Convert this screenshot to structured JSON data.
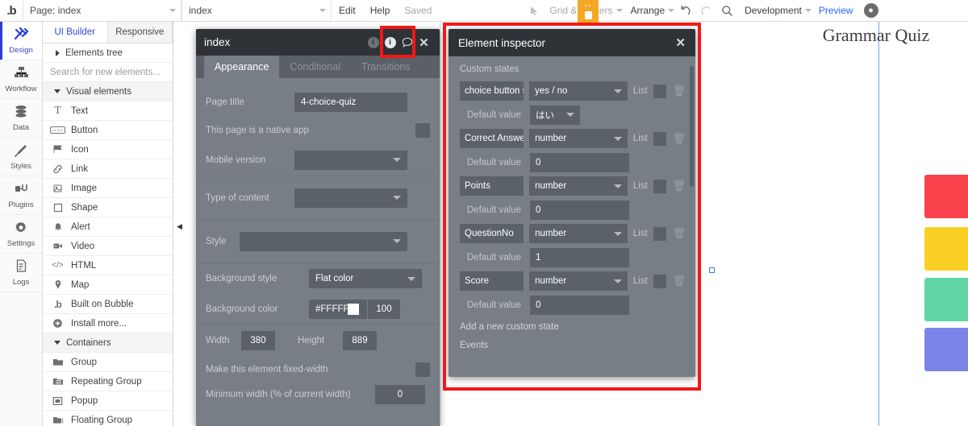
{
  "topbar": {
    "logo": "bubble-logo",
    "page_select": "Page: index",
    "element_select": "index",
    "edit": "Edit",
    "help": "Help",
    "saved": "Saved",
    "grid_borders": "Grid & borders",
    "arrange": "Arrange",
    "undo_icon": "undo-icon",
    "redo_icon": "redo-icon",
    "search_icon": "search-icon",
    "version": "Development",
    "preview": "Preview",
    "avatar_icon": "user-avatar-icon"
  },
  "rail": {
    "items": [
      {
        "label": "Design",
        "icon": "design-tools-icon",
        "active": true
      },
      {
        "label": "Workflow",
        "icon": "workflow-tree-icon",
        "active": false
      },
      {
        "label": "Data",
        "icon": "database-icon",
        "active": false
      },
      {
        "label": "Styles",
        "icon": "paintbrush-icon",
        "active": false
      },
      {
        "label": "Plugins",
        "icon": "plug-icon",
        "active": false
      },
      {
        "label": "Settings",
        "icon": "gear-icon",
        "active": false
      },
      {
        "label": "Logs",
        "icon": "document-icon",
        "active": false
      }
    ]
  },
  "palette": {
    "tabs": [
      {
        "label": "UI Builder",
        "active": true
      },
      {
        "label": "Responsive",
        "active": false
      }
    ],
    "elements_tree": "Elements tree",
    "search_placeholder": "Search for new elements...",
    "groups": [
      {
        "title": "Visual elements",
        "items": [
          {
            "label": "Text",
            "icon": "text-t-icon"
          },
          {
            "label": "Button",
            "icon": "button-icon"
          },
          {
            "label": "Icon",
            "icon": "flag-icon"
          },
          {
            "label": "Link",
            "icon": "link-chain-icon"
          },
          {
            "label": "Image",
            "icon": "image-icon"
          },
          {
            "label": "Shape",
            "icon": "square-shape-icon"
          },
          {
            "label": "Alert",
            "icon": "bell-icon"
          },
          {
            "label": "Video",
            "icon": "video-camera-icon"
          },
          {
            "label": "HTML",
            "icon": "code-brackets-icon"
          },
          {
            "label": "Map",
            "icon": "map-pin-icon"
          },
          {
            "label": "Built on Bubble",
            "icon": "bubble-b-icon"
          },
          {
            "label": "Install more...",
            "icon": "plus-circle-icon"
          }
        ]
      },
      {
        "title": "Containers",
        "items": [
          {
            "label": "Group",
            "icon": "folder-icon"
          },
          {
            "label": "Repeating Group",
            "icon": "repeating-folder-icon"
          },
          {
            "label": "Popup",
            "icon": "popup-window-icon"
          },
          {
            "label": "Floating Group",
            "icon": "floating-folder-icon"
          }
        ]
      }
    ]
  },
  "canvas": {
    "page_title_text": "Grammar Quiz",
    "choice_colors": [
      "#f9424b",
      "#fbd024",
      "#5fd6a4",
      "#7b85e8"
    ]
  },
  "property_panel": {
    "title": "index",
    "header_icons": [
      "info-dim-icon",
      "info-icon",
      "comment-icon",
      "close-icon"
    ],
    "tabs": [
      {
        "label": "Appearance",
        "active": true
      },
      {
        "label": "Conditional",
        "active": false
      },
      {
        "label": "Transitions",
        "active": false
      }
    ],
    "fields": [
      {
        "label": "Page title",
        "type": "text",
        "value": "4-choice-quiz"
      },
      {
        "label": "This page is a native app",
        "type": "checkbox",
        "value": ""
      },
      {
        "label": "Mobile version",
        "type": "select",
        "value": ""
      },
      {
        "label": "Type of content",
        "type": "select",
        "value": ""
      },
      {
        "label": "Style",
        "type": "select",
        "value": ""
      },
      {
        "label": "Background style",
        "type": "select",
        "value": "Flat color"
      },
      {
        "label": "Background color",
        "type": "color",
        "value": "#FFFFFF",
        "opacity": "100"
      },
      {
        "label": "Width",
        "type": "number",
        "value": "380"
      },
      {
        "label": "Height",
        "type": "number",
        "value": "889"
      },
      {
        "label": "Make this element fixed-width",
        "type": "checkbox",
        "value": ""
      },
      {
        "label": "Minimum width (% of current width)",
        "type": "number",
        "value": "0"
      }
    ]
  },
  "inspector": {
    "title": "Element inspector",
    "close_icon": "close-icon",
    "section_label": "Custom states",
    "default_value_label": "Default value",
    "list_label": "List",
    "trash_icon": "trash-icon",
    "states": [
      {
        "name": "choice button s",
        "type": "yes / no",
        "default": "はい",
        "default_is_select": true
      },
      {
        "name": "Correct Answer",
        "type": "number",
        "default": "0",
        "default_is_select": false
      },
      {
        "name": "Points",
        "type": "number",
        "default": "0",
        "default_is_select": false
      },
      {
        "name": "QuestionNo",
        "type": "number",
        "default": "1",
        "default_is_select": false
      },
      {
        "name": "Score",
        "type": "number",
        "default": "0",
        "default_is_select": false
      }
    ],
    "add_state": "Add a new custom state",
    "events": "Events"
  },
  "highlights": {
    "accent_color": "#f01818"
  }
}
